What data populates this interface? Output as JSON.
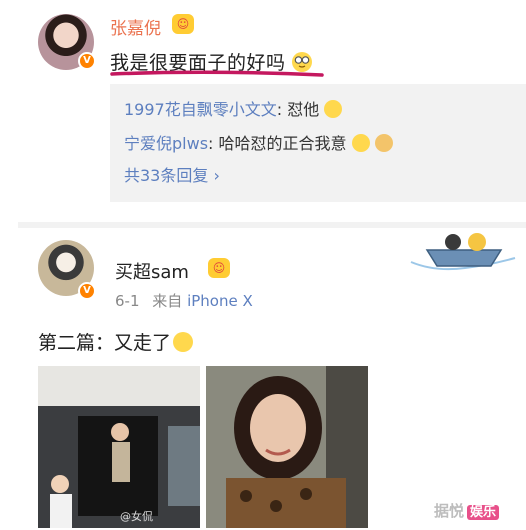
{
  "comment": {
    "author": "张嘉倪",
    "text": "我是很要面子的好吗",
    "replies": [
      {
        "user": "1997花自飘零小文文",
        "text": ": 怼他"
      },
      {
        "user": "宁爱倪plws",
        "text": ": 哈哈怼的正合我意"
      }
    ],
    "more_replies": "共33条回复 ›"
  },
  "post": {
    "author": "买超sam",
    "date": "6-1",
    "from_label": "来自",
    "source": "iPhone X",
    "text": "第二篇：又走了",
    "image_watermark": "@女侃"
  },
  "watermark": {
    "prefix": "据悦",
    "highlight": "娱乐"
  },
  "colors": {
    "accent_orange": "#eb7350",
    "link_blue": "#5d7fbf",
    "underline_magenta": "#c4185f",
    "verified": "#ff8200"
  }
}
